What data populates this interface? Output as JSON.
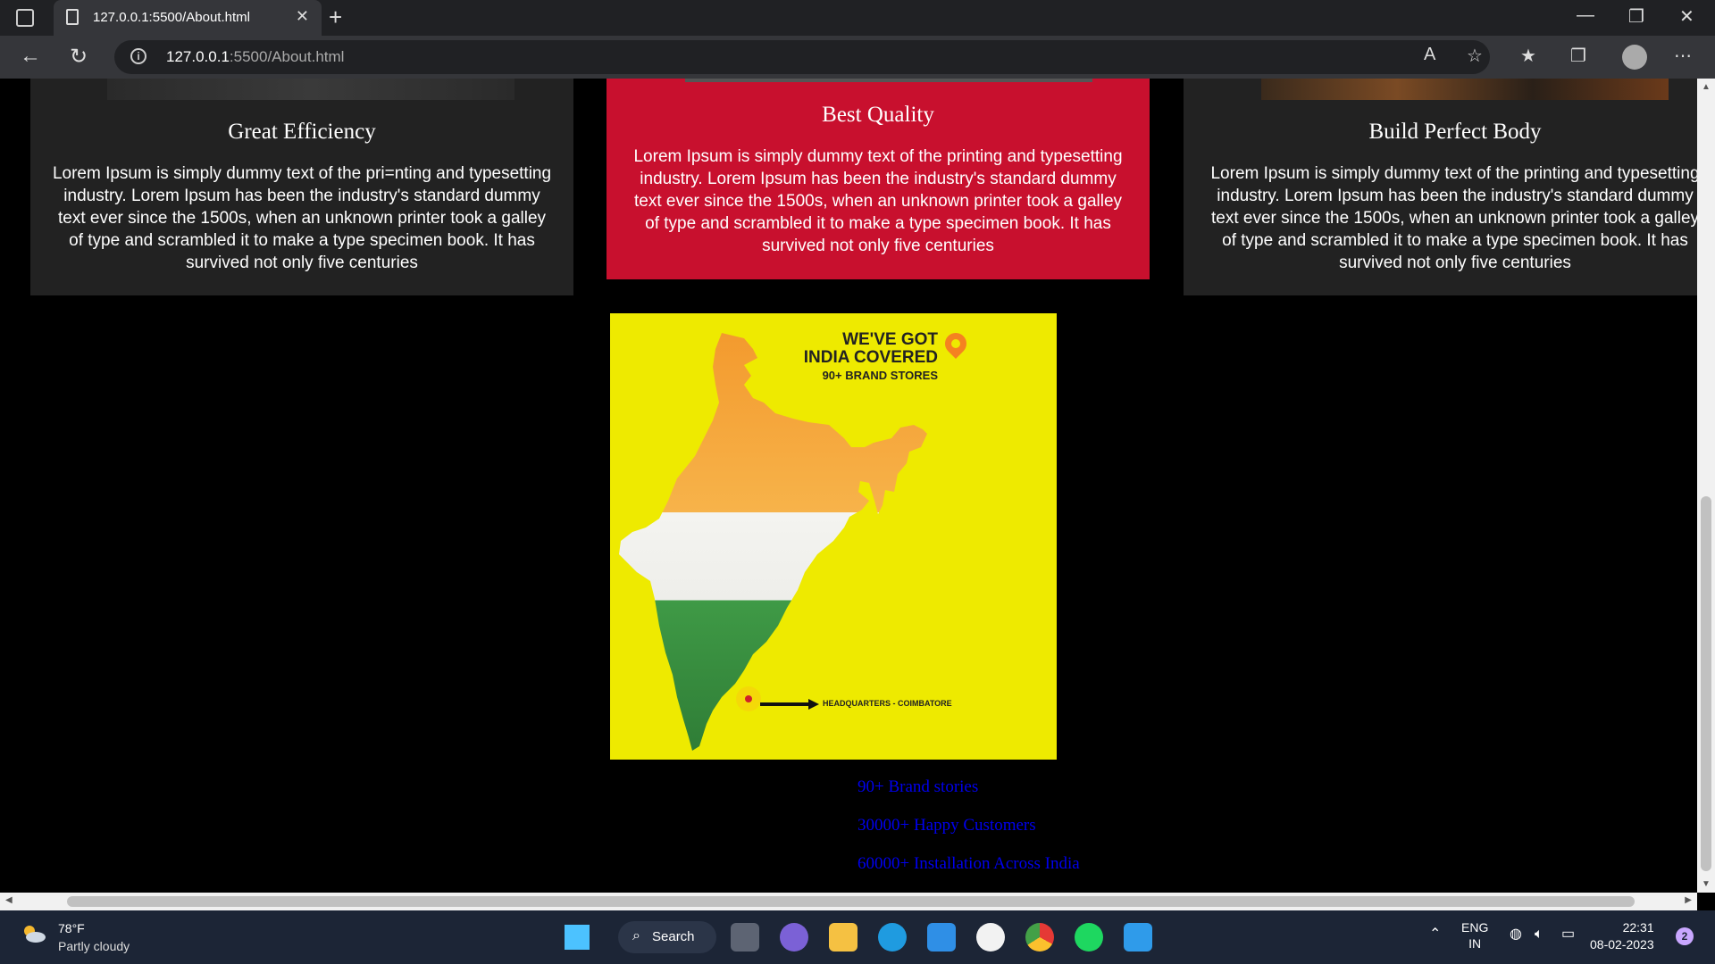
{
  "browser": {
    "tab_title": "127.0.0.1:5500/About.html",
    "tab_close": "✕",
    "new_tab": "+",
    "url_host": "127.0.0.1",
    "url_path": ":5500/About.html",
    "win_minimize": "—",
    "win_restore": "❐",
    "win_close": "✕"
  },
  "cards": [
    {
      "title": "Great Efficiency",
      "text": "Lorem Ipsum is simply dummy text of the pri=nting and typesetting industry. Lorem Ipsum has been the industry's standard dummy text ever since the 1500s, when an unknown printer took a galley of type and scrambled it to make a type specimen book. It has survived not only five centuries"
    },
    {
      "title": "Best Quality",
      "text": "Lorem Ipsum is simply dummy text of the printing and typesetting industry. Lorem Ipsum has been the industry's standard dummy text ever since the 1500s, when an unknown printer took a galley of type and scrambled it to make a type specimen book. It has survived not only five centuries"
    },
    {
      "title": "Build Perfect Body",
      "text": "Lorem Ipsum is simply dummy text of the printing and typesetting industry. Lorem Ipsum has been the industry's standard dummy text ever since the 1500s, when an unknown printer took a galley of type and scrambled it to make a type specimen book. It has survived not only five centuries"
    }
  ],
  "map_image": {
    "heading_line1": "WE'VE GOT",
    "heading_line2": "INDIA COVERED",
    "subheading": "90+ BRAND STORES",
    "hq_label": "HEADQUARTERS - COIMBATORE"
  },
  "stats": [
    "90+ Brand stories",
    "30000+ Happy Customers",
    "60000+ Installation Across India"
  ],
  "taskbar": {
    "temperature": "78°F",
    "weather": "Partly cloudy",
    "search_label": "Search",
    "lang": "ENG",
    "region": "IN",
    "time": "22:31",
    "date": "08-02-2023",
    "notifications": "2"
  },
  "colors": {
    "card_dark": "#222222",
    "card_red": "#c8102e",
    "map_bg": "#eeea00",
    "link": "#0000ee"
  }
}
